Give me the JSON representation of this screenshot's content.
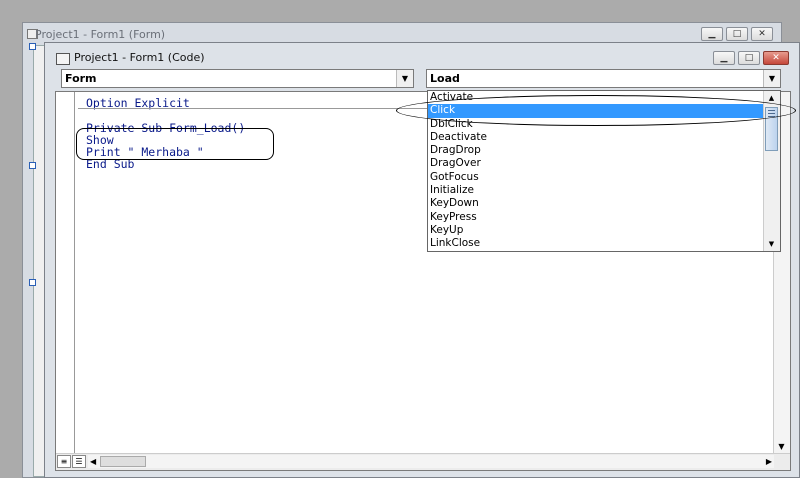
{
  "back_window": {
    "title": "Project1 - Form1 (Form)"
  },
  "front_window": {
    "title": "Project1 - Form1 (Code)"
  },
  "window_controls": {
    "minimize": "▁",
    "maximize": "□",
    "close": "✕"
  },
  "object_combo": {
    "value": "Form"
  },
  "procedure_combo": {
    "value": "Load"
  },
  "code": {
    "lines": [
      "Option Explicit",
      "Private Sub Form_Load()",
      "Show",
      "Print \" Merhaba \"",
      "End Sub"
    ]
  },
  "procedure_list": {
    "items": [
      "Activate",
      "Click",
      "DblClick",
      "Deactivate",
      "DragDrop",
      "DragOver",
      "GotFocus",
      "Initialize",
      "KeyDown",
      "KeyPress",
      "KeyUp",
      "LinkClose"
    ],
    "selected": "Click"
  },
  "colors": {
    "code_text": "#0a1a8a",
    "selection": "#3399ff"
  },
  "icons": {
    "dropdown": "triangle-down",
    "scroll_up": "triangle-up",
    "scroll_down": "triangle-down",
    "scroll_left": "triangle-left",
    "scroll_right": "triangle-right"
  }
}
